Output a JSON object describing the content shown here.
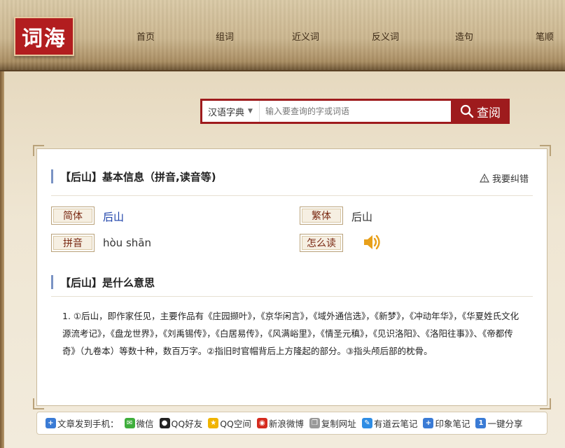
{
  "header": {
    "logo_text": "词海",
    "nav": [
      "首页",
      "组词",
      "近义词",
      "反义词",
      "造句",
      "笔顺"
    ]
  },
  "search": {
    "dict_label": "汉语字典",
    "placeholder": "输入要查询的字或词语",
    "button_label": "查阅"
  },
  "basic": {
    "title": "【后山】基本信息（拼音,读音等)",
    "report_label": "我要纠错",
    "simplified_tag": "简体",
    "simplified_value": "后山",
    "traditional_tag": "繁体",
    "traditional_value": "后山",
    "pinyin_tag": "拼音",
    "pinyin_value": "hòu shān",
    "howto_tag": "怎么读"
  },
  "meaning": {
    "title": "【后山】是什么意思",
    "text": "1. ①后山，即作家任见，主要作品有《庄园撷叶》，《京华闲言》，《域外通信选》，《新梦》，《冲动年华》，《华夏姓氏文化源流考记》，《盘龙世界》，《刘禹锡传》，《白居易传》，《风满峪里》，《情圣元稹》，《见识洛阳》、《洛阳往事》》、《帝都传奇》（九卷本）等数十种，数百万字。②指旧时官帽背后上方隆起的部分。③指头颅后部的枕骨。"
  },
  "share": {
    "label": "文章发到手机：",
    "items": [
      "微信",
      "QQ好友",
      "QQ空间",
      "新浪微博",
      "复制网址",
      "有道云笔记",
      "印象笔记",
      "一键分享"
    ]
  },
  "colors": {
    "brand_red": "#9e1b1d",
    "link_blue": "#1a3fa8"
  }
}
